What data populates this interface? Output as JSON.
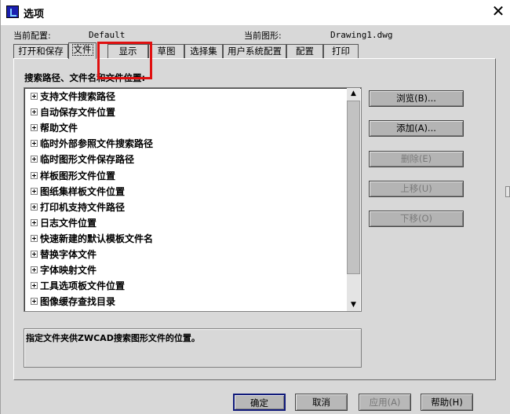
{
  "window": {
    "title": "选项",
    "close_glyph": "✕"
  },
  "info": {
    "current_profile_label": "当前配置:",
    "current_profile_value": "Default",
    "current_drawing_label": "当前图形:",
    "current_drawing_value": "Drawing1.dwg"
  },
  "tabs": [
    {
      "label": "打开和保存",
      "active": false
    },
    {
      "label": "文件",
      "active": true
    },
    {
      "label": "显示",
      "active": false
    },
    {
      "label": "草图",
      "active": false
    },
    {
      "label": "选择集",
      "active": false
    },
    {
      "label": "用户系统配置",
      "active": false
    },
    {
      "label": "配置",
      "active": false
    },
    {
      "label": "打印",
      "active": false
    }
  ],
  "tab_labels": {
    "open_save": "打开和保存",
    "files": "文件",
    "display": "显示",
    "drafting": "草图",
    "selection": "选择集",
    "user_prefs": "用户系统配置",
    "profiles": "配置",
    "plot": "打印"
  },
  "group_label": "搜索路径、文件名和文件位置:",
  "tree_items": [
    "支持文件搜索路径",
    "自动保存文件位置",
    "帮助文件",
    "临时外部参照文件搜索路径",
    "临时图形文件保存路径",
    "样板图形文件位置",
    "图纸集样板文件位置",
    "打印机支持文件路径",
    "日志文件位置",
    "快速新建的默认模板文件名",
    "替换字体文件",
    "字体映射文件",
    "工具选项板文件位置",
    "图像缓存查找目录"
  ],
  "side_buttons": {
    "browse": "浏览(B)...",
    "add": "添加(A)...",
    "delete": "删除(E)",
    "move_up": "上移(U)",
    "move_down": "下移(O)"
  },
  "description": "指定文件夹供ZWCAD搜索图形文件的位置。",
  "bottom_buttons": {
    "ok": "确定",
    "cancel": "取消",
    "apply": "应用(A)",
    "help": "帮助(H)"
  },
  "colors": {
    "dialog_bg": "#d8d8d8",
    "highlight": "#e01010",
    "default_button_border": "#101a7a"
  }
}
